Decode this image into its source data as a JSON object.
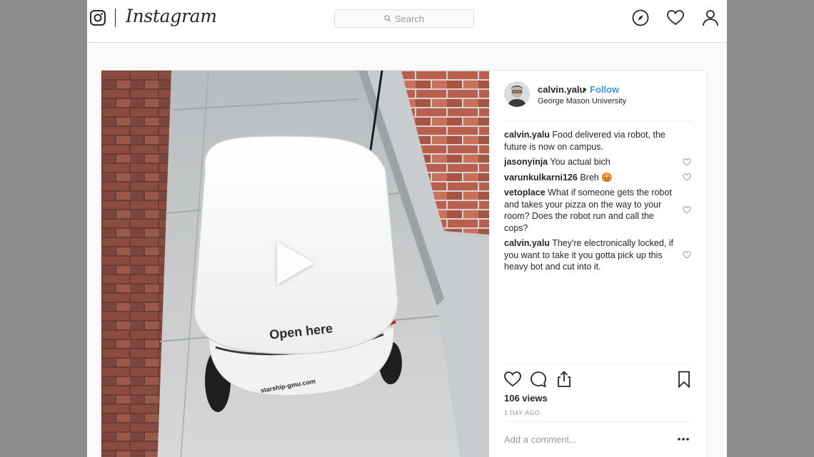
{
  "topbar": {
    "brand": "Instagram",
    "search_placeholder": "Search",
    "icons": [
      "instagram-glyph-icon",
      "compass-icon",
      "heart-icon",
      "profile-icon"
    ]
  },
  "post": {
    "video_overlay_text": "Open here",
    "media_text_lines": [
      "starship-gmu.com"
    ],
    "header": {
      "username": "calvin.yalu",
      "dot": "•",
      "follow": "Follow",
      "location": "George Mason University"
    },
    "comments": [
      {
        "user": "calvin.yalu",
        "text": "Food delivered via robot, the future is now on campus.",
        "has_like": false
      },
      {
        "user": "jasonyinja",
        "text": "You actual bich",
        "has_like": true
      },
      {
        "user": "varunkulkarni126",
        "text": "Breh",
        "emoji": "😡",
        "has_like": true
      },
      {
        "user": "vetoplace",
        "text": "What if someone gets the robot and takes your pizza on the way to your room? Does the robot run and call the cops?",
        "has_like": true
      },
      {
        "user": "calvin.yalu",
        "text": "They're electronically locked, if you want to take it you gotta pick up this heavy bot and cut into it.",
        "has_like": true
      }
    ],
    "views": "106 views",
    "time_ago": "1 DAY AGO",
    "add_comment_placeholder": "Add a comment...",
    "accent_color": "#3897f0"
  }
}
